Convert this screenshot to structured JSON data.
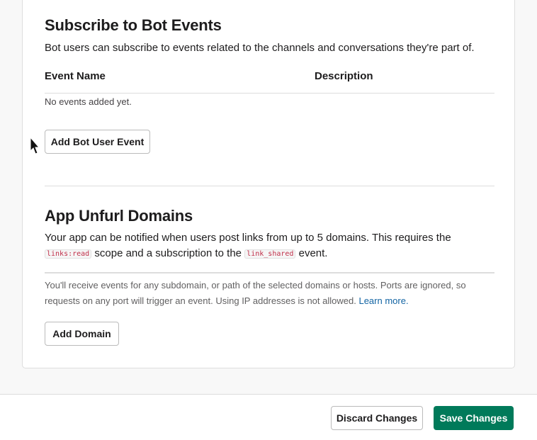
{
  "bot_events": {
    "title": "Subscribe to Bot Events",
    "description": "Bot users can subscribe to events related to the channels and conversations they're part of.",
    "columns": [
      "Event Name",
      "Description"
    ],
    "empty_text": "No events added yet.",
    "add_button": "Add Bot User Event"
  },
  "unfurl": {
    "title": "App Unfurl Domains",
    "desc_part1": "Your app can be notified when users post links from up to 5 domains. This requires the",
    "scope_code": "links:read",
    "desc_part2": "scope and a subscription to the",
    "event_code": "link_shared",
    "desc_part3": "event.",
    "note": "You'll receive events for any subdomain, or path of the selected domains or hosts. Ports are ignored, so requests on any port will trigger an event. Using IP addresses is not allowed.",
    "learn_more": "Learn more.",
    "add_button": "Add Domain"
  },
  "footer": {
    "discard": "Discard Changes",
    "save": "Save Changes"
  },
  "colors": {
    "accent": "#007a5a",
    "link": "#1264a3"
  }
}
